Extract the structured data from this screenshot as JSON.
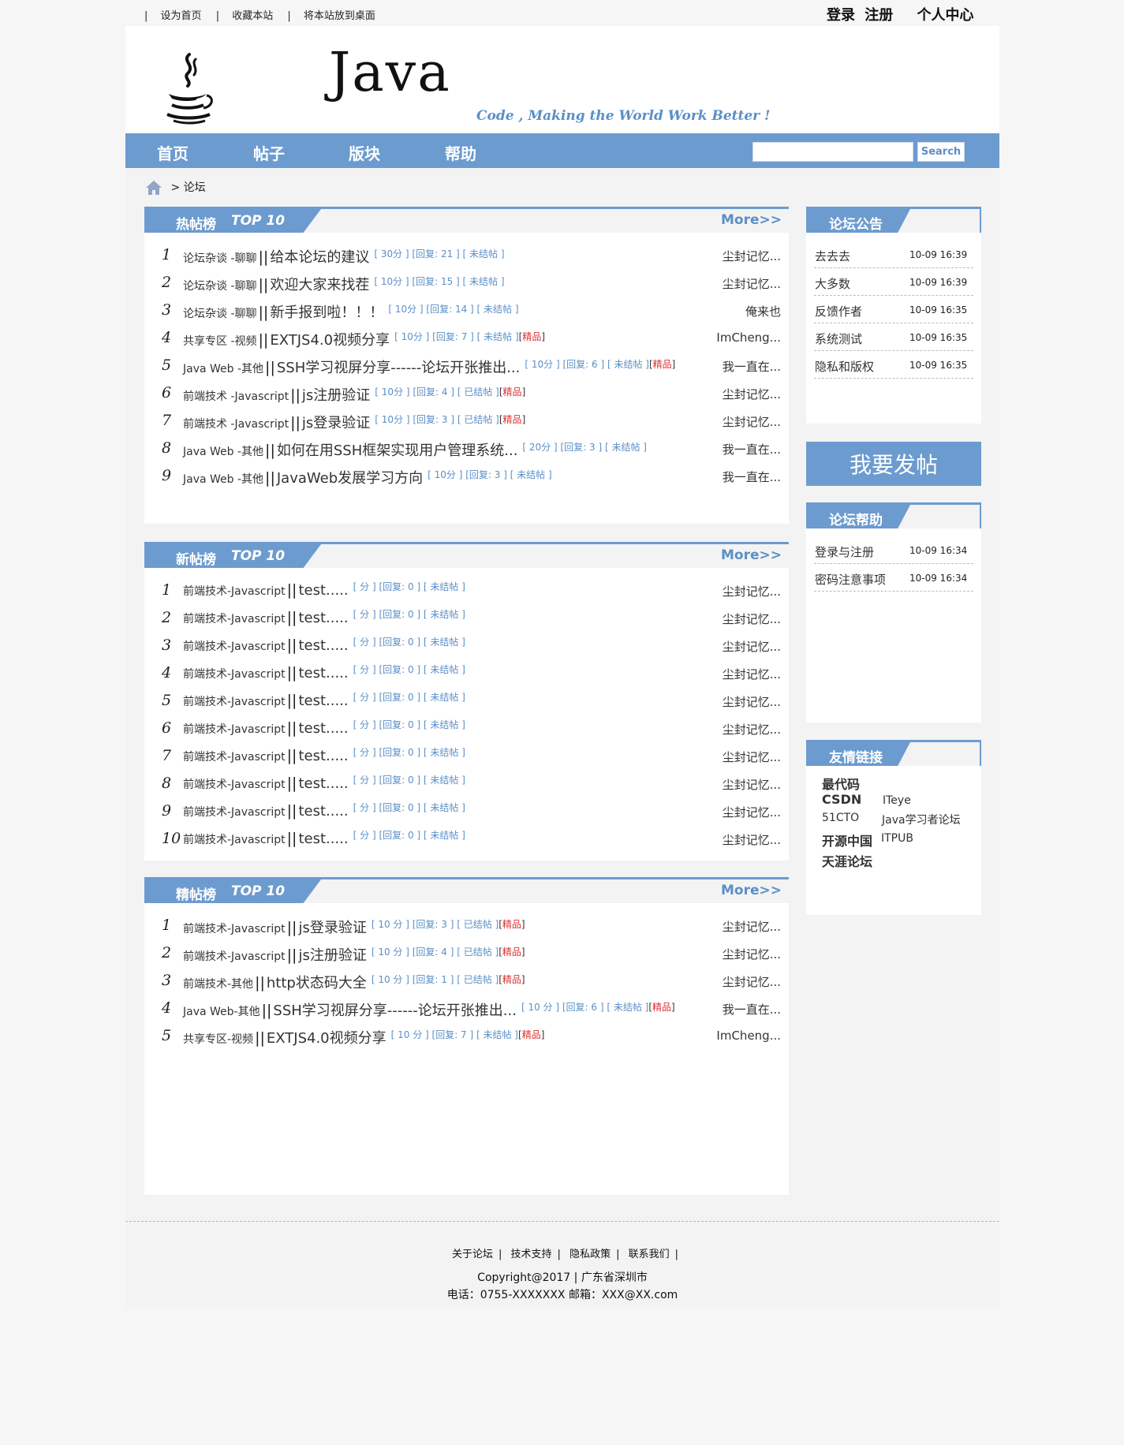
{
  "topbar": {
    "links": [
      "设为首页",
      "收藏本站",
      "将本站放到桌面"
    ],
    "login": "登录",
    "register": "注册",
    "user_center": "个人中心"
  },
  "header": {
    "logo_text": "Java",
    "slogan": "Code , Making the World Work Better !"
  },
  "nav": {
    "items": [
      "首页",
      "帖子",
      "版块",
      "帮助"
    ],
    "search_label": "Search",
    "search_value": ""
  },
  "breadcrumb": {
    "separator": ">",
    "current": "论坛"
  },
  "panels": [
    {
      "title": "热帖榜",
      "subtitle": "TOP 10",
      "more": "More>>",
      "rows": [
        {
          "num": "1",
          "cat": "论坛杂谈 -聊聊",
          "title": "给本论坛的建议",
          "meta": "[ 30分 ] [回复: 21 ] [ 未结帖 ]",
          "tag": "",
          "author": "尘封记忆..."
        },
        {
          "num": "2",
          "cat": "论坛杂谈 -聊聊",
          "title": "欢迎大家来找茬",
          "meta": "[ 10分 ] [回复: 15 ] [ 未结帖 ]",
          "tag": "",
          "author": "尘封记忆..."
        },
        {
          "num": "3",
          "cat": "论坛杂谈 -聊聊",
          "title": "新手报到啦！！！",
          "meta": "[ 10分 ] [回复: 14 ] [ 未结帖 ]",
          "tag": "",
          "author": "俺来也"
        },
        {
          "num": "4",
          "cat": "共享专区 -视频",
          "title": "EXTJS4.0视频分享",
          "meta": "[ 10分 ] [回复: 7 ] [ 未结帖 ]",
          "tag": "精品",
          "author": "ImCheng..."
        },
        {
          "num": "5",
          "cat": "Java Web -其他",
          "title": "SSH学习视屏分享------论坛开张推出...",
          "meta": "[ 10分 ] [回复: 6 ] [ 未结帖 ]",
          "tag": "精品",
          "author": "我一直在..."
        },
        {
          "num": "6",
          "cat": "前端技术 -Javascript",
          "title": "js注册验证",
          "meta": "[ 10分 ] [回复: 4 ] [ 已结帖 ]",
          "tag": "精品",
          "author": "尘封记忆..."
        },
        {
          "num": "7",
          "cat": "前端技术 -Javascript",
          "title": "js登录验证",
          "meta": "[ 10分 ] [回复: 3 ] [ 已结帖 ]",
          "tag": "精品",
          "author": "尘封记忆..."
        },
        {
          "num": "8",
          "cat": "Java Web -其他",
          "title": "如何在用SSH框架实现用户管理系统...",
          "meta": "[ 20分 ] [回复: 3 ] [ 未结帖 ]",
          "tag": "",
          "author": "我一直在..."
        },
        {
          "num": "9",
          "cat": "Java Web -其他",
          "title": "JavaWeb发展学习方向",
          "meta": "[ 10分 ] [回复: 3 ] [ 未结帖 ]",
          "tag": "",
          "author": "我一直在..."
        }
      ]
    },
    {
      "title": "新帖榜",
      "subtitle": "TOP 10",
      "more": "More>>",
      "rows": [
        {
          "num": "1",
          "cat": "前端技术-Javascript",
          "title": "test.....",
          "meta": "[ 分 ] [回复: 0 ] [ 未结帖 ]",
          "tag": "",
          "author": "尘封记忆..."
        },
        {
          "num": "2",
          "cat": "前端技术-Javascript",
          "title": "test.....",
          "meta": "[ 分 ] [回复: 0 ] [ 未结帖 ]",
          "tag": "",
          "author": "尘封记忆..."
        },
        {
          "num": "3",
          "cat": "前端技术-Javascript",
          "title": "test.....",
          "meta": "[ 分 ] [回复: 0 ] [ 未结帖 ]",
          "tag": "",
          "author": "尘封记忆..."
        },
        {
          "num": "4",
          "cat": "前端技术-Javascript",
          "title": "test.....",
          "meta": "[ 分 ] [回复: 0 ] [ 未结帖 ]",
          "tag": "",
          "author": "尘封记忆..."
        },
        {
          "num": "5",
          "cat": "前端技术-Javascript",
          "title": "test.....",
          "meta": "[ 分 ] [回复: 0 ] [ 未结帖 ]",
          "tag": "",
          "author": "尘封记忆..."
        },
        {
          "num": "6",
          "cat": "前端技术-Javascript",
          "title": "test.....",
          "meta": "[ 分 ] [回复: 0 ] [ 未结帖 ]",
          "tag": "",
          "author": "尘封记忆..."
        },
        {
          "num": "7",
          "cat": "前端技术-Javascript",
          "title": "test.....",
          "meta": "[ 分 ] [回复: 0 ] [ 未结帖 ]",
          "tag": "",
          "author": "尘封记忆..."
        },
        {
          "num": "8",
          "cat": "前端技术-Javascript",
          "title": "test.....",
          "meta": "[ 分 ] [回复: 0 ] [ 未结帖 ]",
          "tag": "",
          "author": "尘封记忆..."
        },
        {
          "num": "9",
          "cat": "前端技术-Javascript",
          "title": "test.....",
          "meta": "[ 分 ] [回复: 0 ] [ 未结帖 ]",
          "tag": "",
          "author": "尘封记忆..."
        },
        {
          "num": "10",
          "cat": "前端技术-Javascript",
          "title": "test.....",
          "meta": "[ 分 ] [回复: 0 ] [ 未结帖 ]",
          "tag": "",
          "author": "尘封记忆..."
        }
      ]
    },
    {
      "title": "精帖榜",
      "subtitle": "TOP 10",
      "more": "More>>",
      "rows": [
        {
          "num": "1",
          "cat": "前端技术-Javascript",
          "title": "js登录验证",
          "meta": "[ 10 分 ] [回复: 3 ] [ 已结帖 ]",
          "tag": "精品",
          "author": "尘封记忆..."
        },
        {
          "num": "2",
          "cat": "前端技术-Javascript",
          "title": "js注册验证",
          "meta": "[ 10 分 ] [回复: 4 ] [ 已结帖 ]",
          "tag": "精品",
          "author": "尘封记忆..."
        },
        {
          "num": "3",
          "cat": "前端技术-其他",
          "title": "http状态码大全",
          "meta": "[ 10 分 ] [回复: 1 ] [ 已结帖 ]",
          "tag": "精品",
          "author": "尘封记忆..."
        },
        {
          "num": "4",
          "cat": "Java Web-其他",
          "title": "SSH学习视屏分享------论坛开张推出...",
          "meta": "[ 10 分 ] [回复: 6 ] [ 未结帖 ]",
          "tag": "精品",
          "author": "我一直在..."
        },
        {
          "num": "5",
          "cat": "共享专区-视频",
          "title": "EXTJS4.0视频分享",
          "meta": "[ 10 分 ] [回复: 7 ] [ 未结帖 ]",
          "tag": "精品",
          "author": "ImCheng..."
        }
      ]
    }
  ],
  "sidebar": {
    "notice": {
      "title": "论坛公告",
      "items": [
        {
          "text": "去去去",
          "date": "10-09 16:39"
        },
        {
          "text": "大多数",
          "date": "10-09 16:39"
        },
        {
          "text": "反馈作者",
          "date": "10-09 16:35"
        },
        {
          "text": "系统测试",
          "date": "10-09 16:35"
        },
        {
          "text": "隐私和版权",
          "date": "10-09 16:35"
        }
      ]
    },
    "post_button": "我要发帖",
    "help": {
      "title": "论坛帮助",
      "items": [
        {
          "text": "登录与注册",
          "date": "10-09 16:34"
        },
        {
          "text": "密码注意事项",
          "date": "10-09 16:34"
        }
      ]
    },
    "friends": {
      "title": "友情链接",
      "links": [
        "最代码",
        "CSDN",
        "ITeye",
        "51CTO",
        "Java学习者论坛",
        "开源中国",
        "ITPUB",
        "天涯论坛"
      ]
    }
  },
  "footer": {
    "links": [
      "关于论坛",
      "技术支持",
      "隐私政策",
      "联系我们"
    ],
    "copyright": "Copyright@2017 | 广东省深圳市",
    "contact": "电话：0755-XXXXXXX 邮箱：XXX@XX.com"
  },
  "colors": {
    "accent": "#6c9bcf",
    "link_blue": "#5b8fc7",
    "tag_red": "#e03030",
    "page_bg": "#f6f6f6",
    "content_bg": "#f3f3f3"
  }
}
